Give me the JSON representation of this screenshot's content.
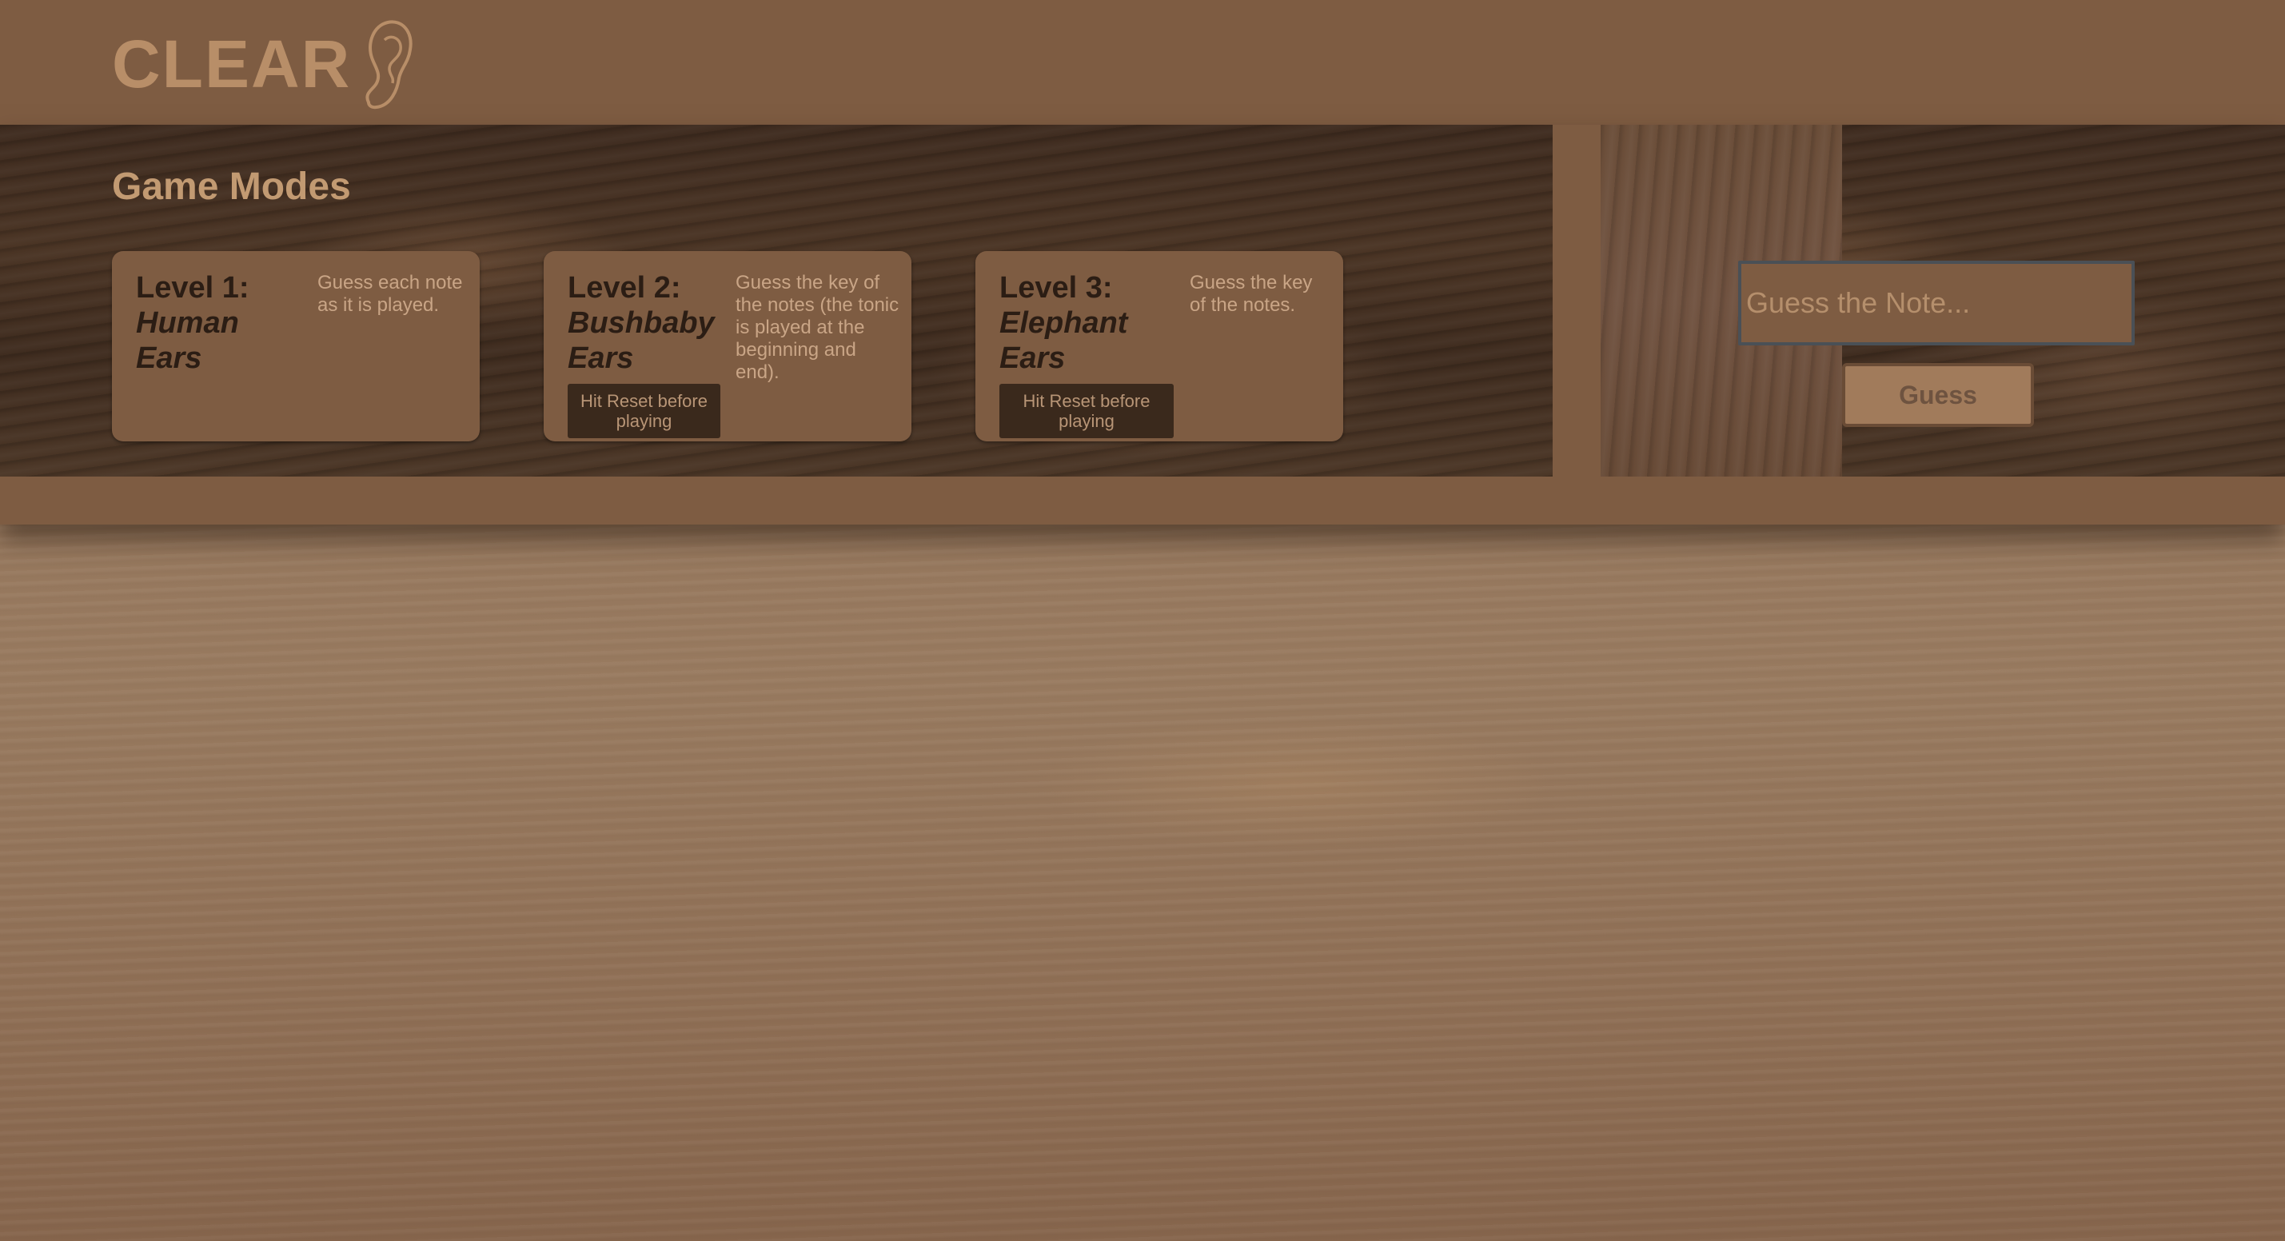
{
  "header": {
    "logo_text": "CLEAR",
    "logo_icon": "ear-icon"
  },
  "game_modes": {
    "title": "Game Modes",
    "levels": [
      {
        "level": "Level 1:",
        "name": "Human Ears",
        "description": "Guess each note as it is played.",
        "reset_label": ""
      },
      {
        "level": "Level 2:",
        "name": "Bushbaby Ears",
        "description": "Guess the key of the notes (the tonic is played at the beginning and end).",
        "reset_label": "Hit Reset before playing"
      },
      {
        "level": "Level 3:",
        "name": "Elephant Ears",
        "description": "Guess the key of the notes.",
        "reset_label": "Hit Reset before playing"
      }
    ]
  },
  "guess": {
    "placeholder": "Guess the Note...",
    "value": "",
    "button_label": "Guess"
  },
  "colors": {
    "header_bg": "#7e5c42",
    "logo": "#b88e68",
    "card_bg": "#7e5c42",
    "heading_dark": "#2b1d14",
    "reset_button_bg": "#3a291c"
  }
}
